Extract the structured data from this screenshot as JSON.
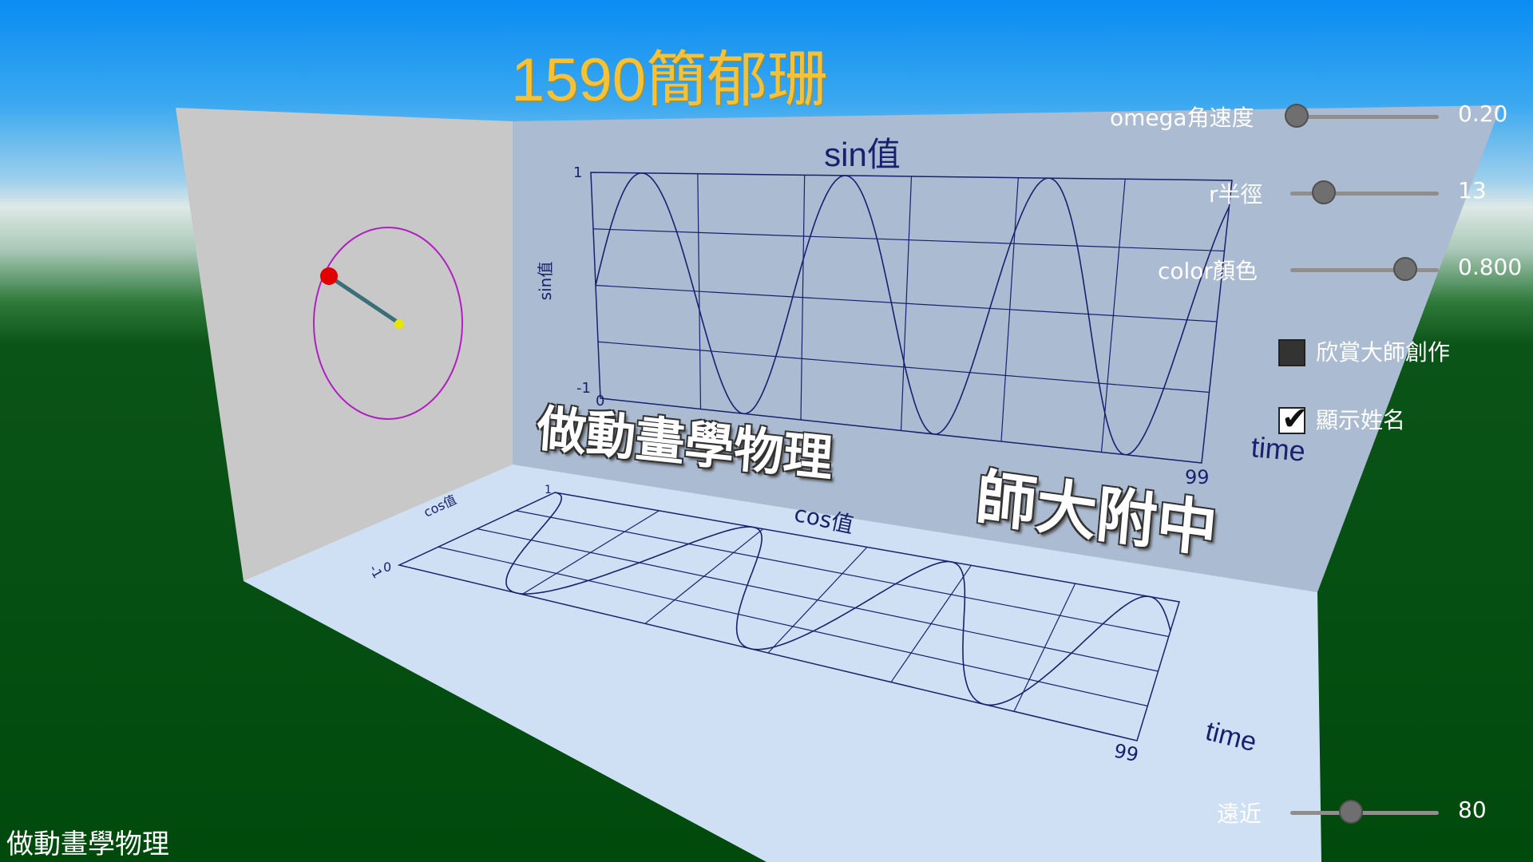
{
  "title": "1590簡郁珊",
  "wall_text": {
    "center": "做動畫學物理",
    "right": "師大附中"
  },
  "footer_caption": "做動畫學物理",
  "controls": {
    "omega": {
      "label": "omega角速度",
      "value": "0.20",
      "level": 0.0
    },
    "radius": {
      "label": "r半徑",
      "value": "13",
      "level": 0.2
    },
    "color": {
      "label": "color顏色",
      "value": "0.800",
      "level": 0.8
    },
    "masterpiece": {
      "label": "欣賞大師創作",
      "checked": false
    },
    "show_name": {
      "label": "顯示姓名",
      "checked": true
    },
    "distance": {
      "label": "遠近",
      "value": "80",
      "level": 0.4
    }
  },
  "chart_data": [
    {
      "type": "line",
      "title": "sin值",
      "xlabel": "time",
      "ylabel": "sin值",
      "xlim": [
        0,
        99
      ],
      "ylim": [
        -1,
        1
      ],
      "tick_labels": {
        "x_min": "0",
        "x_max": "99",
        "y_min": "-1",
        "y_max": "1"
      },
      "grid": true,
      "series": [
        {
          "function": "sin",
          "omega": 0.2
        }
      ]
    },
    {
      "type": "line",
      "title": "cos值",
      "xlabel": "time",
      "ylabel": "cos值",
      "xlim": [
        0,
        99
      ],
      "ylim": [
        -1,
        1
      ],
      "tick_labels": {
        "x_min": "0",
        "x_max": "99",
        "y_min": "-1",
        "y_max": "1"
      },
      "grid": true,
      "series": [
        {
          "function": "cos",
          "omega": 0.2
        }
      ]
    }
  ],
  "colors": {
    "ball": "#e00000",
    "orbit": "#b020c0",
    "rod": "#3a6f7a",
    "pivot": "#e6e600",
    "curve": "#1b1f6e",
    "title": "#f4c23a"
  }
}
